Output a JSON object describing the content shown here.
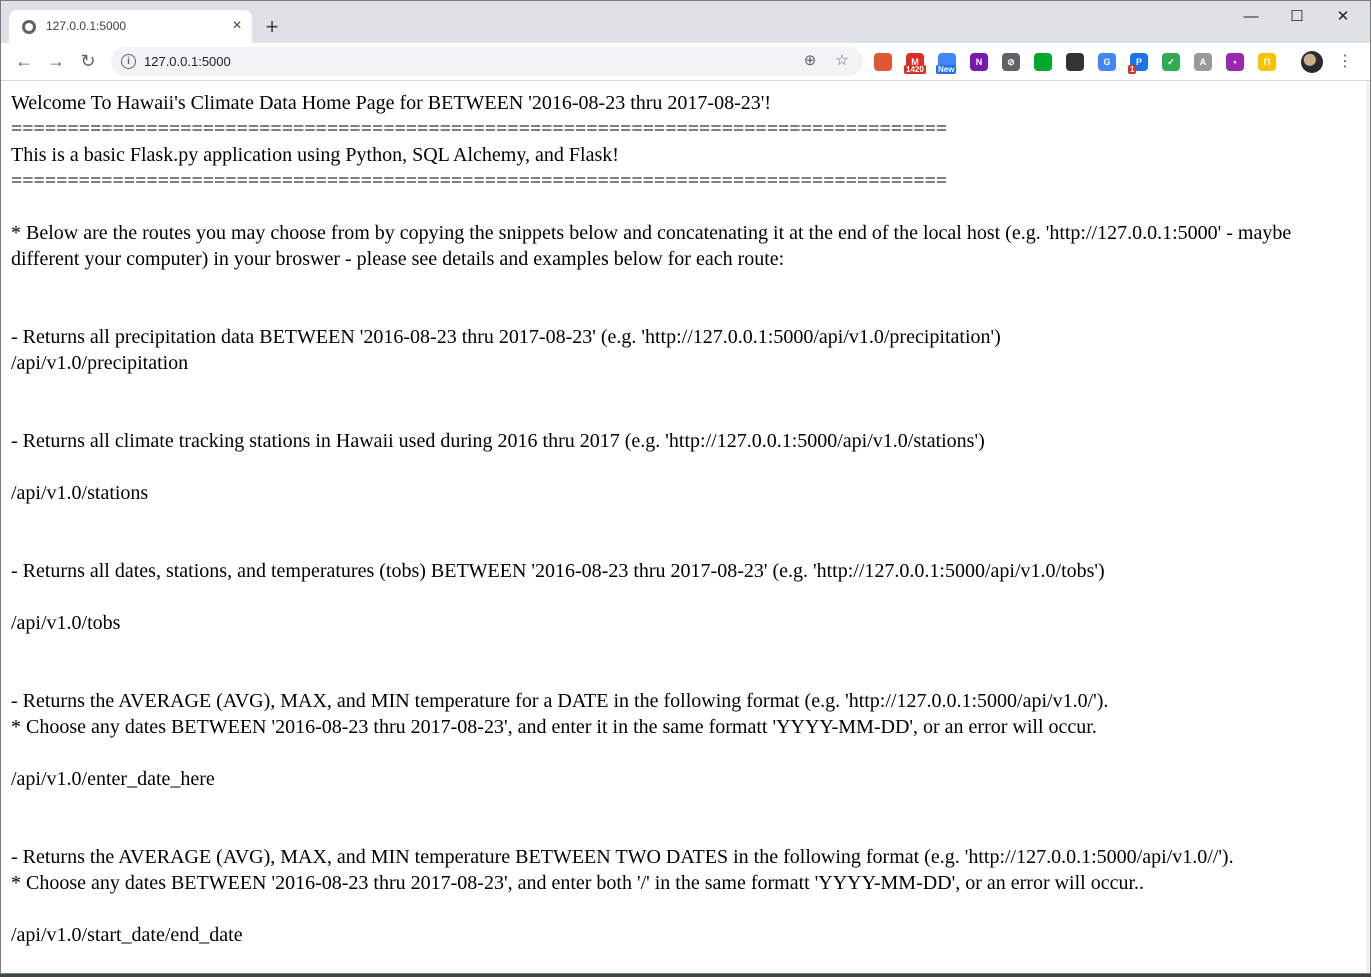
{
  "browser": {
    "tab_title": "127.0.0.1:5000",
    "url": "127.0.0.1:5000",
    "tab_close": "×",
    "new_tab": "+",
    "minimize": "—",
    "maximize": "☐",
    "close": "✕",
    "extensions": [
      {
        "name": "duckduckgo-icon",
        "color": "#de5833",
        "text": ""
      },
      {
        "name": "gmail-checker-icon",
        "color": "#d93025",
        "text": "M",
        "badge": "1420"
      },
      {
        "name": "chrome-extension-new-icon",
        "color": "#4285f4",
        "text": "",
        "badge": "New"
      },
      {
        "name": "onenote-icon",
        "color": "#7719aa",
        "text": "N"
      },
      {
        "name": "block-icon",
        "color": "#5f6368",
        "text": "⊘"
      },
      {
        "name": "evernote-icon",
        "color": "#00a82d",
        "text": ""
      },
      {
        "name": "shades-icon",
        "color": "#333333",
        "text": ""
      },
      {
        "name": "google-translate-icon",
        "color": "#4285f4",
        "text": "G"
      },
      {
        "name": "p-extension-icon",
        "color": "#1a73e8",
        "text": "P",
        "badge": "1"
      },
      {
        "name": "shield-check-icon",
        "color": "#34a853",
        "text": "✓"
      },
      {
        "name": "pdf-icon",
        "color": "#999999",
        "text": "A"
      },
      {
        "name": "purple-extension-icon",
        "color": "#9c27b0",
        "text": "•"
      },
      {
        "name": "yellow-extension-icon",
        "color": "#f5c400",
        "text": "П"
      }
    ]
  },
  "page": {
    "welcome": "Welcome To Hawaii's Climate Data Home Page for BETWEEN '2016-08-23 thru 2017-08-23'!",
    "separator1": "===================================================================================",
    "intro": "This is a basic Flask.py application using Python, SQL Alchemy, and Flask!",
    "separator2": "===================================================================================",
    "routes_intro": "* Below are the routes you may choose from by copying the snippets below and concatenating it at the end of the local host (e.g. 'http://127.0.0.1:5000' - maybe different your computer) in your broswer - please see details and examples below for each route:",
    "routes": {
      "precipitation_desc": "- Returns all precipitation data BETWEEN '2016-08-23 thru 2017-08-23' (e.g. 'http://127.0.0.1:5000/api/v1.0/precipitation')",
      "precipitation_path": "/api/v1.0/precipitation",
      "stations_desc": "- Returns all climate tracking stations in Hawaii used during 2016 thru 2017 (e.g. 'http://127.0.0.1:5000/api/v1.0/stations')",
      "stations_path": "/api/v1.0/stations",
      "tobs_desc": "- Returns all dates, stations, and temperatures (tobs) BETWEEN '2016-08-23 thru 2017-08-23' (e.g. 'http://127.0.0.1:5000/api/v1.0/tobs')",
      "tobs_path": "/api/v1.0/tobs",
      "date_desc": "- Returns the AVERAGE (AVG), MAX, and MIN temperature for a DATE in the following format (e.g. 'http://127.0.0.1:5000/api/v1.0/').",
      "date_note": "* Choose any dates BETWEEN '2016-08-23 thru 2017-08-23', and enter it in the same formatt 'YYYY-MM-DD', or an error will occur.",
      "date_path": "/api/v1.0/enter_date_here",
      "range_desc": "- Returns the AVERAGE (AVG), MAX, and MIN temperature BETWEEN TWO DATES in the following format (e.g. 'http://127.0.0.1:5000/api/v1.0//').",
      "range_note": "* Choose any dates BETWEEN '2016-08-23 thru 2017-08-23', and enter both '/' in the same formatt 'YYYY-MM-DD', or an error will occur..",
      "range_path": "/api/v1.0/start_date/end_date"
    }
  }
}
